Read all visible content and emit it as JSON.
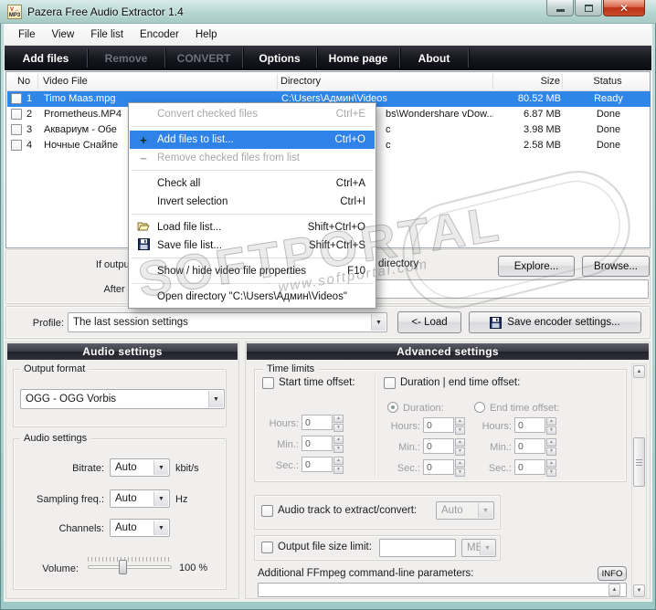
{
  "window": {
    "title": "Pazera Free Audio Extractor 1.4",
    "icon_top": "V→",
    "icon_bottom": "MP3"
  },
  "colors": {
    "selection_blue": "#2e86e8",
    "titlebar_teal": "#b4d4d1",
    "toolbar_dark": "#15151d",
    "panel_header_dark": "#30303a"
  },
  "menubar": {
    "items": [
      "File",
      "View",
      "File list",
      "Encoder",
      "Help"
    ]
  },
  "toolbar": {
    "items": [
      {
        "label": "Add files",
        "enabled": true
      },
      {
        "label": "Remove",
        "enabled": false
      },
      {
        "label": "CONVERT",
        "enabled": false
      },
      {
        "label": "Options",
        "enabled": true
      },
      {
        "label": "Home page",
        "enabled": true
      },
      {
        "label": "About",
        "enabled": true
      }
    ]
  },
  "file_table": {
    "columns": [
      "No",
      "Video File",
      "Directory",
      "Size",
      "Status"
    ],
    "rows": [
      {
        "no": "1",
        "name": "Timo Maas.mpg",
        "directory": "C:\\Users\\Админ\\Videos",
        "size": "80.52 MB",
        "status": "Ready",
        "selected": true
      },
      {
        "no": "2",
        "name": "Prometheus.MP4",
        "directory": "bs\\Wondershare vDow...",
        "size": "6.87 MB",
        "status": "Done",
        "selected": false
      },
      {
        "no": "3",
        "name": "Аквариум - Обе",
        "directory": "c",
        "size": "3.98 MB",
        "status": "Done",
        "selected": false
      },
      {
        "no": "4",
        "name": "Ночные Снайпе",
        "directory": "c",
        "size": "2.58 MB",
        "status": "Done",
        "selected": false
      }
    ]
  },
  "context_menu": {
    "items": [
      {
        "label": "Convert checked files",
        "shortcut": "Ctrl+E",
        "state": "disabled"
      },
      {
        "label": "Add files to list...",
        "shortcut": "Ctrl+O",
        "state": "highlighted",
        "icon_glyph": "+"
      },
      {
        "label": "Remove checked files from list",
        "shortcut": "",
        "state": "disabled",
        "icon_glyph": "−"
      },
      {
        "label": "Check all",
        "shortcut": "Ctrl+A",
        "state": "normal"
      },
      {
        "label": "Invert selection",
        "shortcut": "Ctrl+I",
        "state": "normal"
      },
      {
        "label": "Load file list...",
        "shortcut": "Shift+Ctrl+O",
        "state": "normal"
      },
      {
        "label": "Save file list...",
        "shortcut": "Shift+Ctrl+S",
        "state": "normal"
      },
      {
        "label": "Show / hide video file properties",
        "shortcut": "F10",
        "state": "normal"
      },
      {
        "label": "Open directory \"C:\\Users\\Админ\\Videos\"",
        "shortcut": "",
        "state": "normal"
      }
    ]
  },
  "output_options": {
    "if_exists_label": "If output file exists:",
    "if_exists_visible_value": "directory",
    "explore_button": "Explore...",
    "browse_button": "Browse...",
    "after_conversion_label": "After conversion:",
    "after_conversion_value": ""
  },
  "profile": {
    "label": "Profile:",
    "value": "The last session settings",
    "load_button": "<- Load",
    "save_button": "Save encoder settings..."
  },
  "audio_panel": {
    "header": "Audio settings",
    "output_format_group": "Output format",
    "output_format_value": "OGG - OGG Vorbis",
    "settings_group": "Audio settings",
    "bitrate_label": "Bitrate:",
    "bitrate_value": "Auto",
    "bitrate_unit": "kbit/s",
    "sampling_label": "Sampling freq.:",
    "sampling_value": "Auto",
    "sampling_unit": "Hz",
    "channels_label": "Channels:",
    "channels_value": "Auto",
    "volume_label": "Volume:",
    "volume_value": "100 %"
  },
  "advanced_panel": {
    "header": "Advanced settings",
    "time_limits_group": "Time limits",
    "start_offset_label": "Start time offset:",
    "duration_label": "Duration | end time offset:",
    "radio_duration": "Duration:",
    "radio_end": "End time offset:",
    "hours_label": "Hours:",
    "min_label": "Min.:",
    "sec_label": "Sec.:",
    "spin_value": "0",
    "audio_track_label": "Audio track to extract/convert:",
    "audio_track_value": "Auto",
    "size_limit_label": "Output file size limit:",
    "size_limit_value": "",
    "size_limit_unit": "MB",
    "ffmpeg_label": "Additional FFmpeg command-line parameters:",
    "ffmpeg_value": "",
    "info_button": "INFO"
  },
  "watermark": {
    "line1": "SOFTPORTAL",
    "line2": "www.softportal.com"
  }
}
